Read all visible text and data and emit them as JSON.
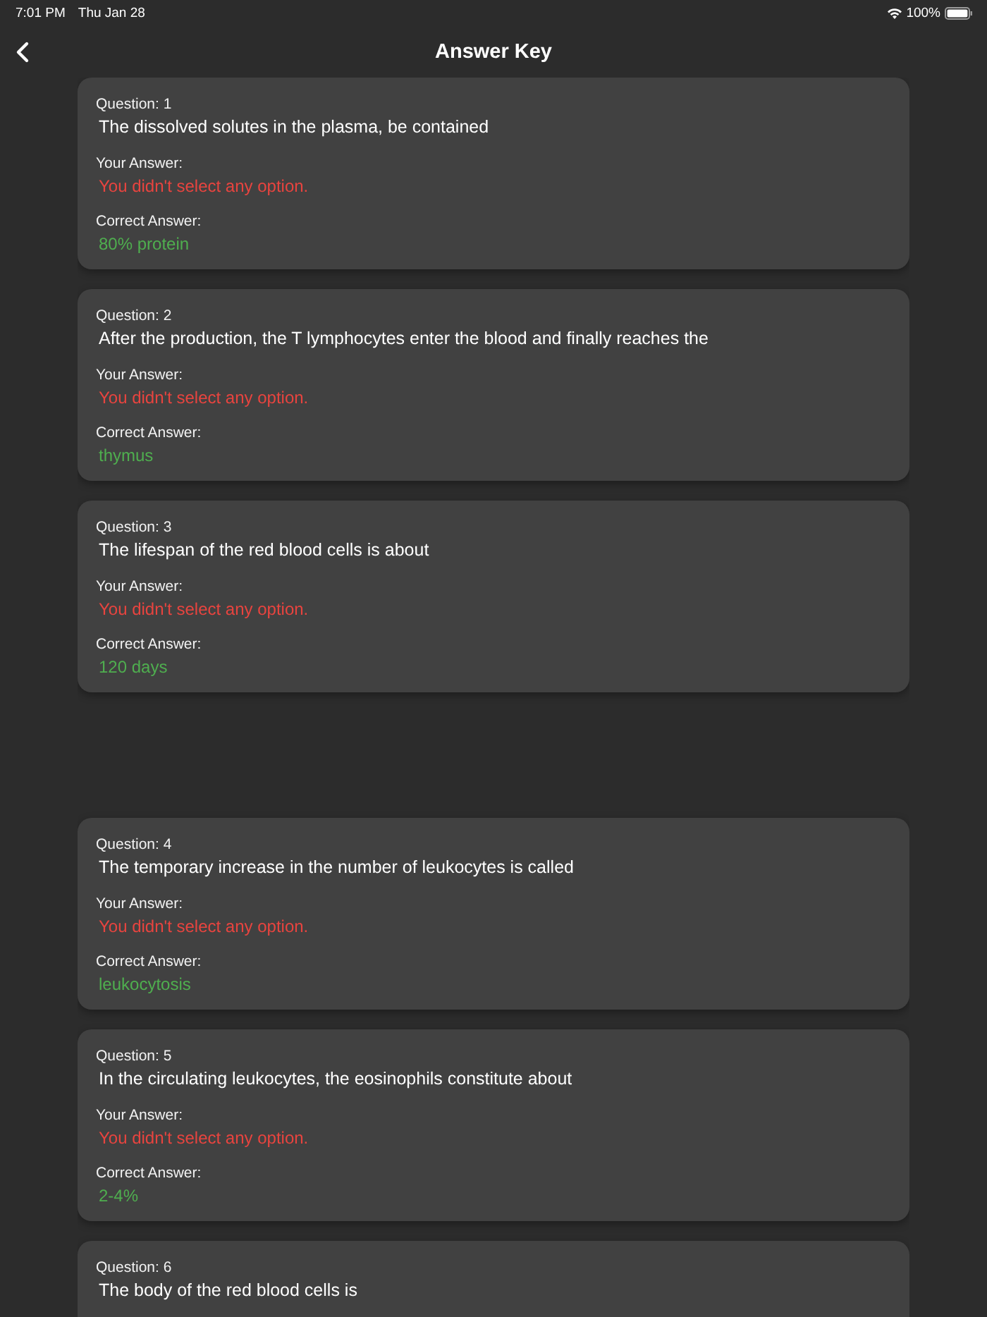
{
  "status_bar": {
    "time": "7:01 PM",
    "date": "Thu Jan 28",
    "battery": "100%"
  },
  "nav": {
    "title": "Answer Key"
  },
  "sections": [
    {
      "questions": [
        {
          "label": "Question: 1",
          "text": "The dissolved solutes in the plasma, be contained",
          "your_label": "Your Answer:",
          "your_answer": "You didn't select any option.",
          "correct_label": "Correct Answer:",
          "correct_answer": "80% protein"
        },
        {
          "label": "Question: 2",
          "text": "After the production, the T lymphocytes enter the blood and finally reaches the",
          "your_label": "Your Answer:",
          "your_answer": "You didn't select any option.",
          "correct_label": "Correct Answer:",
          "correct_answer": "thymus"
        },
        {
          "label": "Question: 3",
          "text": "The lifespan of the red blood cells is about",
          "your_label": "Your Answer:",
          "your_answer": "You didn't select any option.",
          "correct_label": "Correct Answer:",
          "correct_answer": "120 days"
        }
      ]
    },
    {
      "questions": [
        {
          "label": "Question: 4",
          "text": "The temporary increase in the number of leukocytes is called",
          "your_label": "Your Answer:",
          "your_answer": "You didn't select any option.",
          "correct_label": "Correct Answer:",
          "correct_answer": "leukocytosis"
        },
        {
          "label": "Question: 5",
          "text": "In the circulating leukocytes, the eosinophils constitute about",
          "your_label": "Your Answer:",
          "your_answer": "You didn't select any option.",
          "correct_label": "Correct Answer:",
          "correct_answer": "2-4%"
        },
        {
          "label": "Question: 6",
          "text": "The body of the red blood cells is"
        }
      ]
    }
  ]
}
